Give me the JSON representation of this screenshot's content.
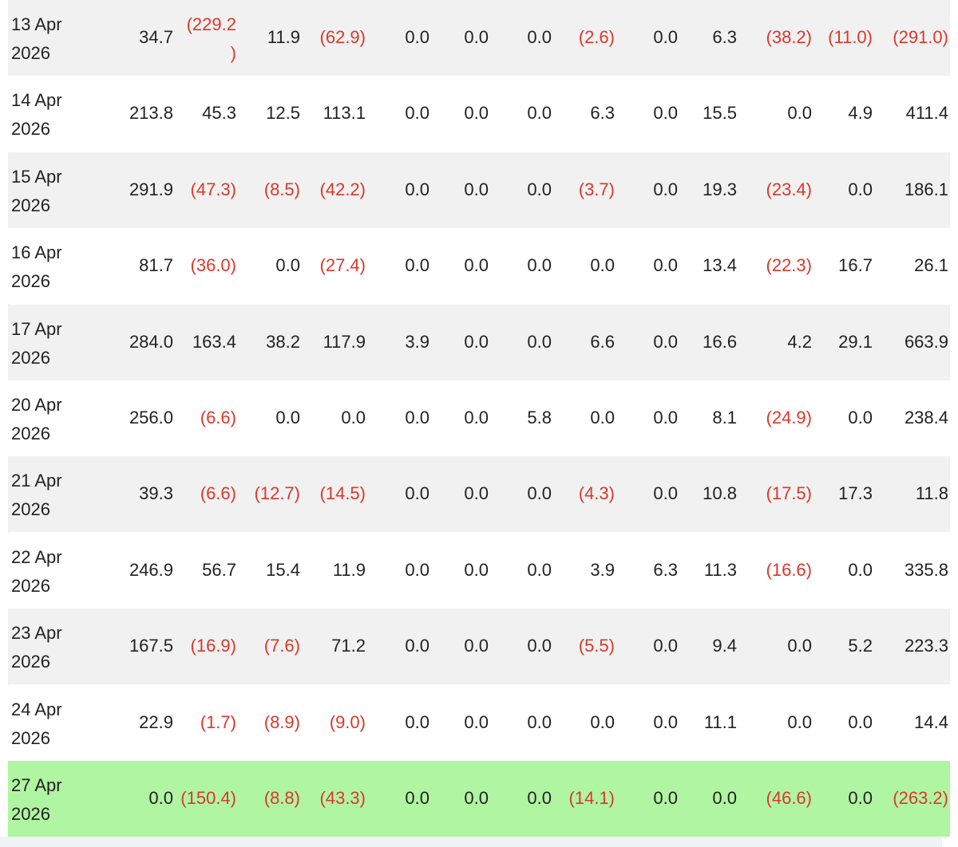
{
  "table": {
    "rows": [
      {
        "date_line1": "13 Apr",
        "date_line2": "2026",
        "values": [
          "34.7",
          "(229.2\n)",
          "11.9",
          "(62.9)",
          "0.0",
          "0.0",
          "0.0",
          "(2.6)",
          "0.0",
          "6.3",
          "(38.2)",
          "(11.0)",
          "(291.0)"
        ]
      },
      {
        "date_line1": "14 Apr",
        "date_line2": "2026",
        "values": [
          "213.8",
          "45.3",
          "12.5",
          "113.1",
          "0.0",
          "0.0",
          "0.0",
          "6.3",
          "0.0",
          "15.5",
          "0.0",
          "4.9",
          "411.4"
        ]
      },
      {
        "date_line1": "15 Apr",
        "date_line2": "2026",
        "values": [
          "291.9",
          "(47.3)",
          "(8.5)",
          "(42.2)",
          "0.0",
          "0.0",
          "0.0",
          "(3.7)",
          "0.0",
          "19.3",
          "(23.4)",
          "0.0",
          "186.1"
        ]
      },
      {
        "date_line1": "16 Apr",
        "date_line2": "2026",
        "values": [
          "81.7",
          "(36.0)",
          "0.0",
          "(27.4)",
          "0.0",
          "0.0",
          "0.0",
          "0.0",
          "0.0",
          "13.4",
          "(22.3)",
          "16.7",
          "26.1"
        ]
      },
      {
        "date_line1": "17 Apr",
        "date_line2": "2026",
        "values": [
          "284.0",
          "163.4",
          "38.2",
          "117.9",
          "3.9",
          "0.0",
          "0.0",
          "6.6",
          "0.0",
          "16.6",
          "4.2",
          "29.1",
          "663.9"
        ]
      },
      {
        "date_line1": "20 Apr",
        "date_line2": "2026",
        "values": [
          "256.0",
          "(6.6)",
          "0.0",
          "0.0",
          "0.0",
          "0.0",
          "5.8",
          "0.0",
          "0.0",
          "8.1",
          "(24.9)",
          "0.0",
          "238.4"
        ]
      },
      {
        "date_line1": "21 Apr",
        "date_line2": "2026",
        "values": [
          "39.3",
          "(6.6)",
          "(12.7)",
          "(14.5)",
          "0.0",
          "0.0",
          "0.0",
          "(4.3)",
          "0.0",
          "10.8",
          "(17.5)",
          "17.3",
          "11.8"
        ]
      },
      {
        "date_line1": "22 Apr",
        "date_line2": "2026",
        "values": [
          "246.9",
          "56.7",
          "15.4",
          "11.9",
          "0.0",
          "0.0",
          "0.0",
          "3.9",
          "6.3",
          "11.3",
          "(16.6)",
          "0.0",
          "335.8"
        ]
      },
      {
        "date_line1": "23 Apr",
        "date_line2": "2026",
        "values": [
          "167.5",
          "(16.9)",
          "(7.6)",
          "71.2",
          "0.0",
          "0.0",
          "0.0",
          "(5.5)",
          "0.0",
          "9.4",
          "0.0",
          "5.2",
          "223.3"
        ]
      },
      {
        "date_line1": "24 Apr",
        "date_line2": "2026",
        "values": [
          "22.9",
          "(1.7)",
          "(8.9)",
          "(9.0)",
          "0.0",
          "0.0",
          "0.0",
          "0.0",
          "0.0",
          "11.1",
          "0.0",
          "0.0",
          "14.4"
        ]
      },
      {
        "date_line1": "27 Apr",
        "date_line2": "2026",
        "values": [
          "0.0",
          "(150.4)",
          "(8.8)",
          "(43.3)",
          "0.0",
          "0.0",
          "0.0",
          "(14.1)",
          "0.0",
          "0.0",
          "(46.6)",
          "0.0",
          "(263.2)"
        ],
        "highlighted": true
      }
    ]
  },
  "colors": {
    "negative_text": "#d8392b",
    "row_alt": "#f1f1f1",
    "row_plain": "#ffffff",
    "row_highlight": "#b0f5a1",
    "text": "#222222"
  }
}
